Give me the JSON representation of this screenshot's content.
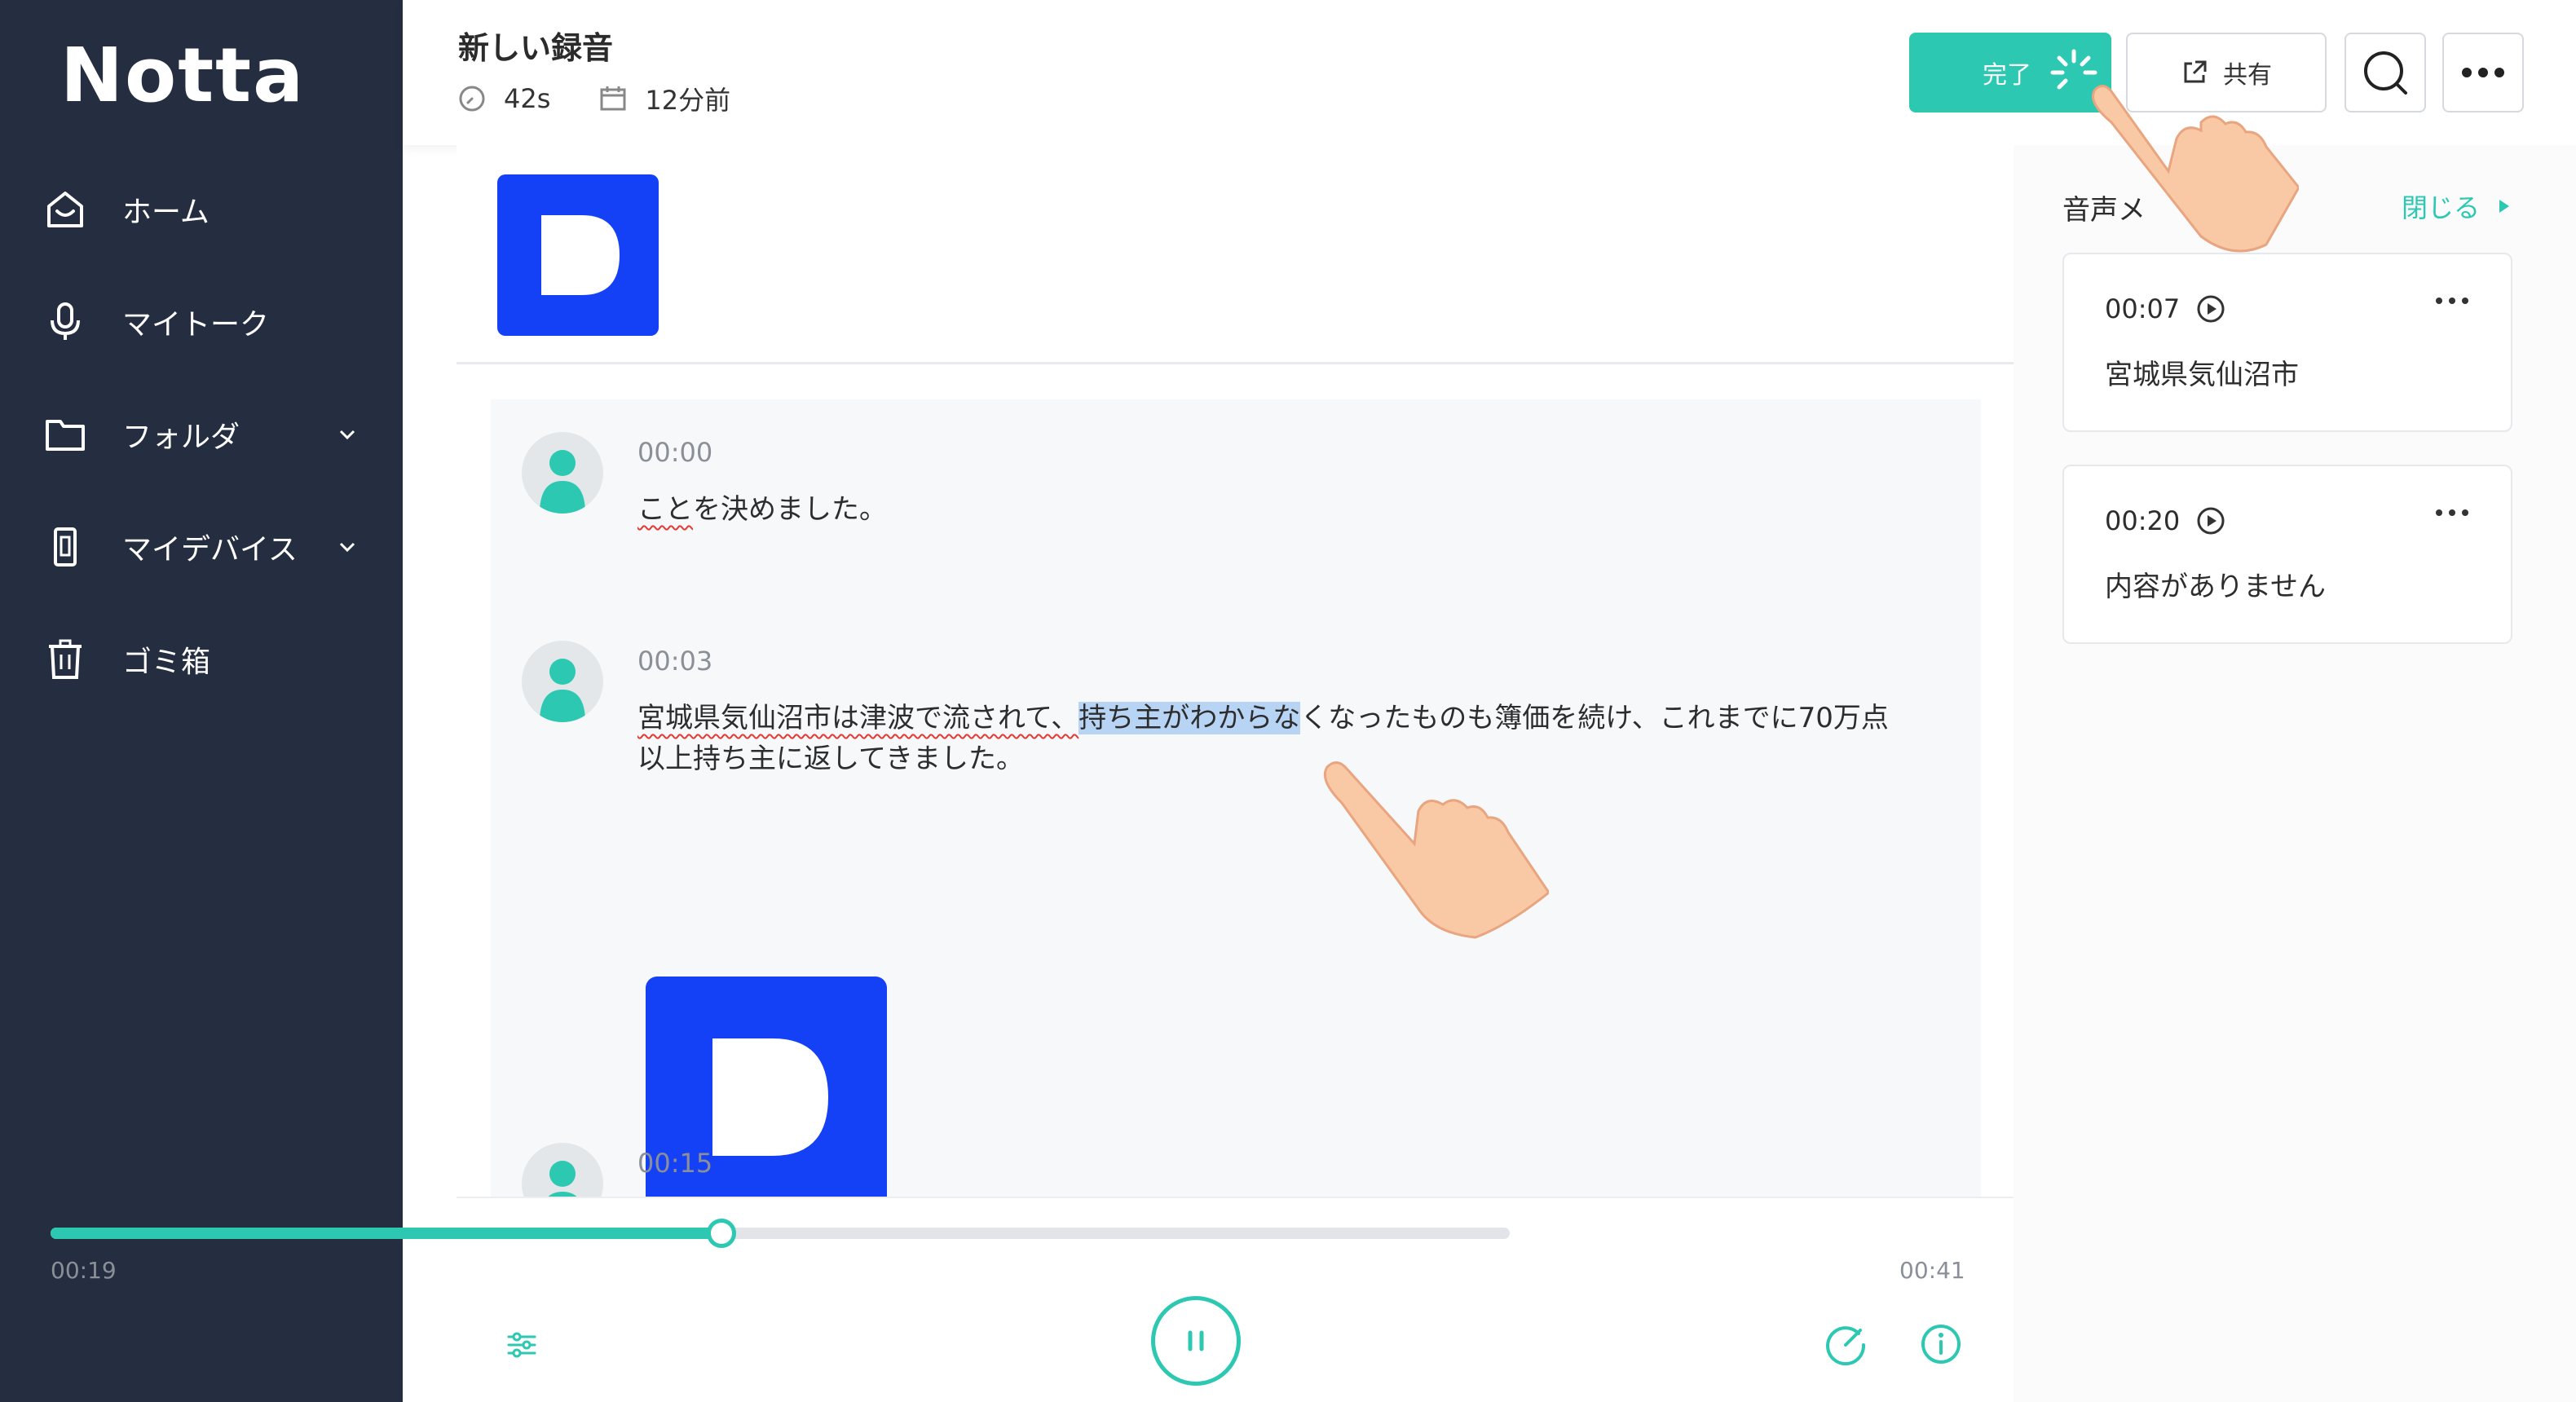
{
  "app": {
    "logo_text": "Notta"
  },
  "sidebar": {
    "items": [
      {
        "label": "ホーム",
        "icon": "home-icon"
      },
      {
        "label": "マイトーク",
        "icon": "microphone-icon"
      },
      {
        "label": "フォルダ",
        "icon": "folder-icon",
        "expandable": true
      },
      {
        "label": "マイデバイス",
        "icon": "device-icon",
        "expandable": true
      },
      {
        "label": "ゴミ箱",
        "icon": "trash-icon"
      }
    ]
  },
  "header": {
    "title": "新しい録音",
    "duration": "42s",
    "created": "12分前",
    "done_label": "完了",
    "share_label": "共有"
  },
  "transcript": {
    "entries": [
      {
        "time": "00:00",
        "text": "ことを決めました。"
      },
      {
        "time": "00:03",
        "line1_a": "宮城県気仙沼市は津波で流されて、",
        "line1_highlight": "持ち主がわからな",
        "line1_b": "くなったものも簿価を続け、これまでに70万点",
        "line2": "以上持ち主に返してきました。"
      },
      {
        "time": "00:15"
      }
    ]
  },
  "player": {
    "current": "00:19",
    "total": "00:41",
    "progress_fraction": 0.46
  },
  "notes_panel": {
    "title": "音声メ",
    "close_label": "閉じる",
    "notes": [
      {
        "time": "00:07",
        "text": "宮城県気仙沼市"
      },
      {
        "time": "00:20",
        "text": "内容がありません"
      }
    ]
  },
  "colors": {
    "sidebar_bg": "#252e40",
    "accent": "#2cc8b2",
    "brand_blue": "#1441f5",
    "highlight": "#b8d4f5"
  }
}
